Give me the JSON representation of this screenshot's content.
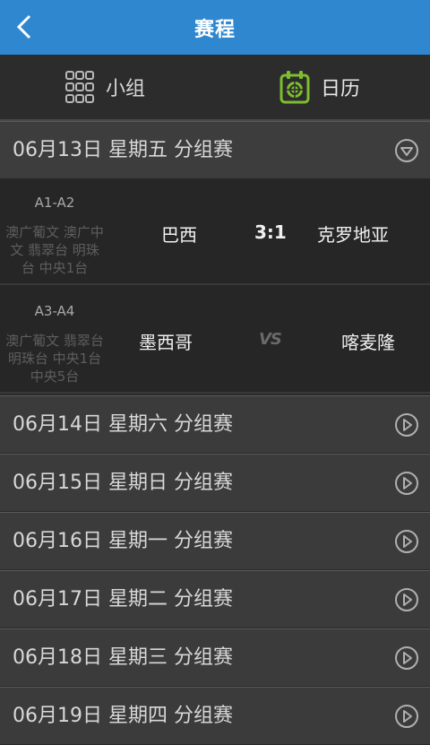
{
  "header": {
    "title": "赛程",
    "back_icon": "back-chevron-icon"
  },
  "tabs": [
    {
      "label": "小组",
      "icon": "grid-icon"
    },
    {
      "label": "日历",
      "icon": "calendar-icon",
      "accent": "#7dbd2e"
    }
  ],
  "days": [
    {
      "label": "06月13日 星期五 分组赛",
      "state": "expanded"
    },
    {
      "label": "06月14日 星期六 分组赛",
      "state": "collapsed"
    },
    {
      "label": "06月15日 星期日 分组赛",
      "state": "collapsed"
    },
    {
      "label": "06月16日 星期一 分组赛",
      "state": "collapsed"
    },
    {
      "label": "06月17日 星期二 分组赛",
      "state": "collapsed"
    },
    {
      "label": "06月18日 星期三 分组赛",
      "state": "collapsed"
    },
    {
      "label": "06月19日 星期四 分组赛",
      "state": "collapsed"
    }
  ],
  "matches": [
    {
      "code": "A1-A2",
      "channels": "澳广葡文 澳广中文 翡翠台 明珠台 中央1台",
      "home": "巴西",
      "score": "3:1",
      "away": "克罗地亚"
    },
    {
      "code": "A3-A4",
      "channels": "澳广葡文 翡翠台 明珠台 中央1台 中央5台",
      "home": "墨西哥",
      "score": "VS",
      "away": "喀麦隆"
    }
  ],
  "colors": {
    "titlebar": "#2f87cf",
    "background": "#2a2a2a",
    "accent_green": "#7dbd2e"
  }
}
